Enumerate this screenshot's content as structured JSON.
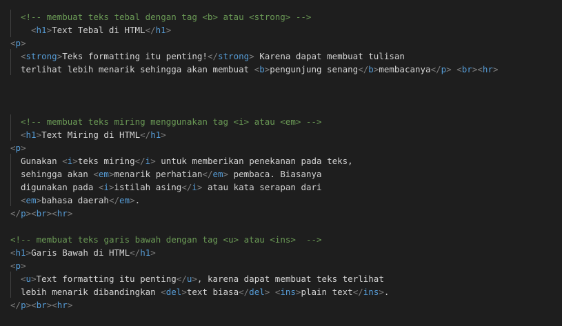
{
  "editor": {
    "colors": {
      "background": "#1e1e1e",
      "comment": "#6a9955",
      "tag": "#569cd6",
      "bracket": "#808080",
      "text": "#d4d4d4",
      "indent_guide": "#404040"
    },
    "lines": [
      {
        "indent": 2,
        "tokens": [
          {
            "k": "c",
            "v": "<!-- membuat teks tebal dengan tag <b> atau <strong> -->"
          }
        ]
      },
      {
        "indent": 4,
        "tokens": [
          {
            "k": "b",
            "v": "<"
          },
          {
            "k": "t",
            "v": "h1"
          },
          {
            "k": "b",
            "v": ">"
          },
          {
            "k": "x",
            "v": "Text Tebal di HTML"
          },
          {
            "k": "b",
            "v": "</"
          },
          {
            "k": "t",
            "v": "h1"
          },
          {
            "k": "b",
            "v": ">"
          }
        ]
      },
      {
        "indent": 0,
        "tokens": [
          {
            "k": "b",
            "v": "<"
          },
          {
            "k": "t",
            "v": "p"
          },
          {
            "k": "b",
            "v": ">"
          }
        ]
      },
      {
        "indent": 2,
        "tokens": [
          {
            "k": "b",
            "v": "<"
          },
          {
            "k": "t",
            "v": "strong"
          },
          {
            "k": "b",
            "v": ">"
          },
          {
            "k": "x",
            "v": "Teks formatting itu penting!"
          },
          {
            "k": "b",
            "v": "</"
          },
          {
            "k": "t",
            "v": "strong"
          },
          {
            "k": "b",
            "v": ">"
          },
          {
            "k": "x",
            "v": " Karena dapat membuat tulisan"
          }
        ]
      },
      {
        "indent": 2,
        "tokens": [
          {
            "k": "x",
            "v": "terlihat lebih menarik sehingga akan membuat "
          },
          {
            "k": "b",
            "v": "<"
          },
          {
            "k": "t",
            "v": "b"
          },
          {
            "k": "b",
            "v": ">"
          },
          {
            "k": "x",
            "v": "pengunjung senang"
          },
          {
            "k": "b",
            "v": "</"
          },
          {
            "k": "t",
            "v": "b"
          },
          {
            "k": "b",
            "v": ">"
          },
          {
            "k": "x",
            "v": "membacanya"
          },
          {
            "k": "b",
            "v": "</"
          },
          {
            "k": "t",
            "v": "p"
          },
          {
            "k": "b",
            "v": ">"
          },
          {
            "k": "x",
            "v": " "
          },
          {
            "k": "b",
            "v": "<"
          },
          {
            "k": "t",
            "v": "br"
          },
          {
            "k": "b",
            "v": "><"
          },
          {
            "k": "t",
            "v": "hr"
          },
          {
            "k": "b",
            "v": ">"
          }
        ]
      },
      {
        "indent": 0,
        "tokens": []
      },
      {
        "indent": 0,
        "tokens": []
      },
      {
        "indent": 0,
        "tokens": []
      },
      {
        "indent": 2,
        "tokens": [
          {
            "k": "c",
            "v": "<!-- membuat teks miring menggunakan tag <i> atau <em> -->"
          }
        ]
      },
      {
        "indent": 2,
        "tokens": [
          {
            "k": "b",
            "v": "<"
          },
          {
            "k": "t",
            "v": "h1"
          },
          {
            "k": "b",
            "v": ">"
          },
          {
            "k": "x",
            "v": "Text Miring di HTML"
          },
          {
            "k": "b",
            "v": "</"
          },
          {
            "k": "t",
            "v": "h1"
          },
          {
            "k": "b",
            "v": ">"
          }
        ]
      },
      {
        "indent": 0,
        "tokens": [
          {
            "k": "b",
            "v": "<"
          },
          {
            "k": "t",
            "v": "p"
          },
          {
            "k": "b",
            "v": ">"
          }
        ]
      },
      {
        "indent": 2,
        "tokens": [
          {
            "k": "x",
            "v": "Gunakan "
          },
          {
            "k": "b",
            "v": "<"
          },
          {
            "k": "t",
            "v": "i"
          },
          {
            "k": "b",
            "v": ">"
          },
          {
            "k": "x",
            "v": "teks miring"
          },
          {
            "k": "b",
            "v": "</"
          },
          {
            "k": "t",
            "v": "i"
          },
          {
            "k": "b",
            "v": ">"
          },
          {
            "k": "x",
            "v": " untuk memberikan penekanan pada teks,"
          }
        ]
      },
      {
        "indent": 2,
        "tokens": [
          {
            "k": "x",
            "v": "sehingga akan "
          },
          {
            "k": "b",
            "v": "<"
          },
          {
            "k": "t",
            "v": "em"
          },
          {
            "k": "b",
            "v": ">"
          },
          {
            "k": "x",
            "v": "menarik perhatian"
          },
          {
            "k": "b",
            "v": "</"
          },
          {
            "k": "t",
            "v": "em"
          },
          {
            "k": "b",
            "v": ">"
          },
          {
            "k": "x",
            "v": " pembaca. Biasanya"
          }
        ]
      },
      {
        "indent": 2,
        "tokens": [
          {
            "k": "x",
            "v": "digunakan pada "
          },
          {
            "k": "b",
            "v": "<"
          },
          {
            "k": "t",
            "v": "i"
          },
          {
            "k": "b",
            "v": ">"
          },
          {
            "k": "x",
            "v": "istilah asing"
          },
          {
            "k": "b",
            "v": "</"
          },
          {
            "k": "t",
            "v": "i"
          },
          {
            "k": "b",
            "v": ">"
          },
          {
            "k": "x",
            "v": " atau kata serapan dari"
          }
        ]
      },
      {
        "indent": 2,
        "tokens": [
          {
            "k": "b",
            "v": "<"
          },
          {
            "k": "t",
            "v": "em"
          },
          {
            "k": "b",
            "v": ">"
          },
          {
            "k": "x",
            "v": "bahasa daerah"
          },
          {
            "k": "b",
            "v": "</"
          },
          {
            "k": "t",
            "v": "em"
          },
          {
            "k": "b",
            "v": ">"
          },
          {
            "k": "x",
            "v": "."
          }
        ]
      },
      {
        "indent": 0,
        "tokens": [
          {
            "k": "b",
            "v": "</"
          },
          {
            "k": "t",
            "v": "p"
          },
          {
            "k": "b",
            "v": "><"
          },
          {
            "k": "t",
            "v": "br"
          },
          {
            "k": "b",
            "v": "><"
          },
          {
            "k": "t",
            "v": "hr"
          },
          {
            "k": "b",
            "v": ">"
          }
        ]
      },
      {
        "indent": 0,
        "tokens": []
      },
      {
        "indent": 0,
        "tokens": [
          {
            "k": "c",
            "v": "<!-- membuat teks garis bawah dengan tag <u> atau <ins>  -->"
          }
        ]
      },
      {
        "indent": 0,
        "tokens": [
          {
            "k": "b",
            "v": "<"
          },
          {
            "k": "t",
            "v": "h1"
          },
          {
            "k": "b",
            "v": ">"
          },
          {
            "k": "x",
            "v": "Garis Bawah di HTML"
          },
          {
            "k": "b",
            "v": "</"
          },
          {
            "k": "t",
            "v": "h1"
          },
          {
            "k": "b",
            "v": ">"
          }
        ]
      },
      {
        "indent": 0,
        "tokens": [
          {
            "k": "b",
            "v": "<"
          },
          {
            "k": "t",
            "v": "p"
          },
          {
            "k": "b",
            "v": ">"
          }
        ]
      },
      {
        "indent": 2,
        "tokens": [
          {
            "k": "b",
            "v": "<"
          },
          {
            "k": "t",
            "v": "u"
          },
          {
            "k": "b",
            "v": ">"
          },
          {
            "k": "x",
            "v": "Text formatting itu penting"
          },
          {
            "k": "b",
            "v": "</"
          },
          {
            "k": "t",
            "v": "u"
          },
          {
            "k": "b",
            "v": ">"
          },
          {
            "k": "x",
            "v": ", karena dapat membuat teks terlihat"
          }
        ]
      },
      {
        "indent": 2,
        "tokens": [
          {
            "k": "x",
            "v": "lebih menarik dibandingkan "
          },
          {
            "k": "b",
            "v": "<"
          },
          {
            "k": "t",
            "v": "del"
          },
          {
            "k": "b",
            "v": ">"
          },
          {
            "k": "x",
            "v": "text biasa"
          },
          {
            "k": "b",
            "v": "</"
          },
          {
            "k": "t",
            "v": "del"
          },
          {
            "k": "b",
            "v": ">"
          },
          {
            "k": "x",
            "v": " "
          },
          {
            "k": "b",
            "v": "<"
          },
          {
            "k": "t",
            "v": "ins"
          },
          {
            "k": "b",
            "v": ">"
          },
          {
            "k": "x",
            "v": "plain text"
          },
          {
            "k": "b",
            "v": "</"
          },
          {
            "k": "t",
            "v": "ins"
          },
          {
            "k": "b",
            "v": ">"
          },
          {
            "k": "x",
            "v": "."
          }
        ]
      },
      {
        "indent": 0,
        "tokens": [
          {
            "k": "b",
            "v": "</"
          },
          {
            "k": "t",
            "v": "p"
          },
          {
            "k": "b",
            "v": "><"
          },
          {
            "k": "t",
            "v": "br"
          },
          {
            "k": "b",
            "v": "><"
          },
          {
            "k": "t",
            "v": "hr"
          },
          {
            "k": "b",
            "v": ">"
          }
        ]
      }
    ]
  }
}
